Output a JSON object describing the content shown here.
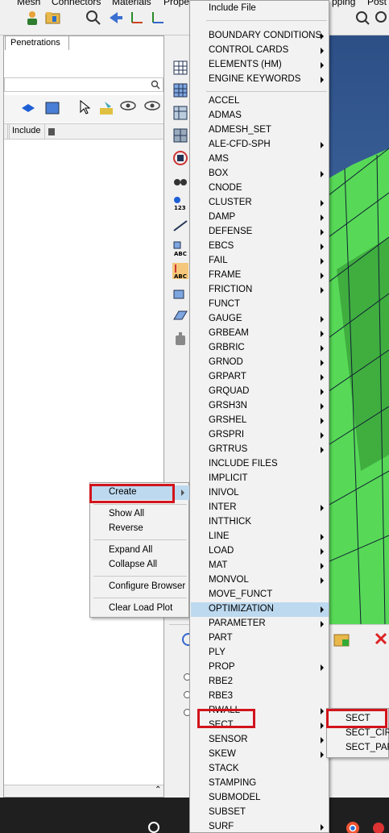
{
  "top_menu_fragments": [
    "Mesh",
    "Connectors",
    "Materials",
    "Prope",
    "pping",
    "Post"
  ],
  "browser": {
    "tab_label": "Penetrations",
    "columns": [
      "Include"
    ]
  },
  "context_menu": {
    "items": [
      {
        "label": "Create",
        "highlighted": true,
        "submenu": true
      },
      {
        "label": "Show All"
      },
      {
        "label": "Reverse"
      },
      {
        "label": "Expand All"
      },
      {
        "label": "Collapse All"
      },
      {
        "label": "Configure Browser"
      },
      {
        "label": "Clear Load Plot"
      }
    ]
  },
  "keyword_menu": {
    "items": [
      {
        "label": "Include File",
        "submenu": false
      },
      {
        "label": "BOUNDARY CONDITIONS",
        "submenu": true
      },
      {
        "label": "CONTROL CARDS",
        "submenu": true
      },
      {
        "label": "ELEMENTS (HM)",
        "submenu": true
      },
      {
        "label": "ENGINE KEYWORDS",
        "submenu": true
      },
      {
        "label": "ACCEL",
        "submenu": false
      },
      {
        "label": "ADMAS",
        "submenu": false
      },
      {
        "label": "ADMESH_SET",
        "submenu": false
      },
      {
        "label": "ALE-CFD-SPH",
        "submenu": true
      },
      {
        "label": "AMS",
        "submenu": false
      },
      {
        "label": "BOX",
        "submenu": true
      },
      {
        "label": "CNODE",
        "submenu": false
      },
      {
        "label": "CLUSTER",
        "submenu": true
      },
      {
        "label": "DAMP",
        "submenu": true
      },
      {
        "label": "DEFENSE",
        "submenu": true
      },
      {
        "label": "EBCS",
        "submenu": true
      },
      {
        "label": "FAIL",
        "submenu": true
      },
      {
        "label": "FRAME",
        "submenu": true
      },
      {
        "label": "FRICTION",
        "submenu": true
      },
      {
        "label": "FUNCT",
        "submenu": false
      },
      {
        "label": "GAUGE",
        "submenu": true
      },
      {
        "label": "GRBEAM",
        "submenu": true
      },
      {
        "label": "GRBRIC",
        "submenu": true
      },
      {
        "label": "GRNOD",
        "submenu": true
      },
      {
        "label": "GRPART",
        "submenu": true
      },
      {
        "label": "GRQUAD",
        "submenu": true
      },
      {
        "label": "GRSH3N",
        "submenu": true
      },
      {
        "label": "GRSHEL",
        "submenu": true
      },
      {
        "label": "GRSPRI",
        "submenu": true
      },
      {
        "label": "GRTRUS",
        "submenu": true
      },
      {
        "label": "INCLUDE FILES",
        "submenu": false
      },
      {
        "label": "IMPLICIT",
        "submenu": false
      },
      {
        "label": "INIVOL",
        "submenu": false
      },
      {
        "label": "INTER",
        "submenu": true
      },
      {
        "label": "INTTHICK",
        "submenu": false
      },
      {
        "label": "LINE",
        "submenu": true
      },
      {
        "label": "LOAD",
        "submenu": true
      },
      {
        "label": "MAT",
        "submenu": true
      },
      {
        "label": "MONVOL",
        "submenu": true
      },
      {
        "label": "MOVE_FUNCT",
        "submenu": false
      },
      {
        "label": "OPTIMIZATION",
        "submenu": true,
        "highlighted": true
      },
      {
        "label": "PARAMETER",
        "submenu": true
      },
      {
        "label": "PART",
        "submenu": false
      },
      {
        "label": "PLY",
        "submenu": false
      },
      {
        "label": "PROP",
        "submenu": true
      },
      {
        "label": "RBE2",
        "submenu": false
      },
      {
        "label": "RBE3",
        "submenu": false
      },
      {
        "label": "RWALL",
        "submenu": true
      },
      {
        "label": "SECT",
        "submenu": true
      },
      {
        "label": "SENSOR",
        "submenu": true
      },
      {
        "label": "SKEW",
        "submenu": true
      },
      {
        "label": "STACK",
        "submenu": false
      },
      {
        "label": "STAMPING",
        "submenu": false
      },
      {
        "label": "SUBMODEL",
        "submenu": false
      },
      {
        "label": "SUBSET",
        "submenu": false
      },
      {
        "label": "SURF",
        "submenu": true
      }
    ]
  },
  "sect_submenu": {
    "items": [
      {
        "label": "SECT"
      },
      {
        "label": "SECT_CIRC"
      },
      {
        "label": "SECT_PARAL"
      }
    ]
  },
  "colors": {
    "highlight": "#bcd9ef",
    "callout": "#d2141c",
    "mesh_green": "#57d957",
    "background_blue": "#3a5f9a"
  }
}
